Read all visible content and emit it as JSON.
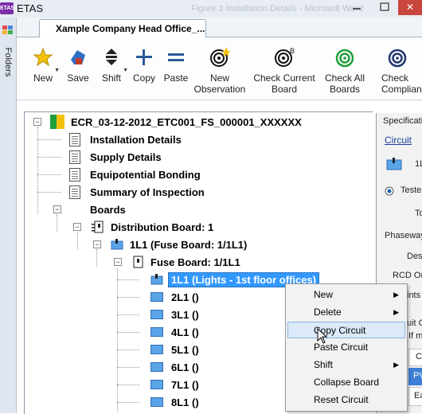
{
  "app": {
    "title": "ETAS",
    "icon_text": "ETAS",
    "ghost_title": "Figure 3 Installation Details - Microsoft Word"
  },
  "sidebar": {
    "label": "Folders"
  },
  "tab": {
    "label": "Xample Company Head Office_..."
  },
  "ribbon": {
    "new": "New",
    "save": "Save",
    "shift": "Shift",
    "copy": "Copy",
    "paste": "Paste",
    "new_observation_1": "New",
    "new_observation_2": "Observation",
    "check_current_1": "Check Current",
    "check_current_2": "Board",
    "check_all_1": "Check All",
    "check_all_2": "Boards",
    "check_compliance_1": "Check",
    "check_compliance_2": "Compliance"
  },
  "tree": {
    "root": "ECR_03-12-2012_ETC001_FS_000001_XXXXXX",
    "installation": "Installation Details",
    "supply": "Supply Details",
    "bonding": "Equipotential Bonding",
    "inspection": "Summary of Inspection",
    "boards": "Boards",
    "distribution": "Distribution Board: 1",
    "fuse_board_1": "1L1 (Fuse Board: 1/1L1)",
    "fuse_board_2": "Fuse Board: 1/1L1",
    "circuits": [
      "1L1 (Lights - 1st floor offices)",
      "2L1 ()",
      "3L1 ()",
      "4L1 ()",
      "5L1 ()",
      "6L1 ()",
      "7L1 ()",
      "8L1 ()"
    ]
  },
  "right_panel": {
    "spec": "Specificatio",
    "circuit": "Circuit",
    "circuit_id": "1L",
    "tested": "Teste",
    "to": "To",
    "phaseway": "Phaseway",
    "des": "Des",
    "rcd": "RCD Or",
    "ints": "ints",
    "uit": "uit C",
    "ifm": "If m",
    "c": "C",
    "pv": "PV",
    "ea": "Ea"
  },
  "context_menu": {
    "items": [
      "New",
      "Delete",
      "Copy Circuit",
      "Paste Circuit",
      "Shift",
      "Collapse Board",
      "Reset Circuit"
    ]
  },
  "colors": {
    "selection": "#3399ff",
    "accent_orange": "#f39a1c",
    "green": "#1e9f3a",
    "navy": "#23356f"
  }
}
